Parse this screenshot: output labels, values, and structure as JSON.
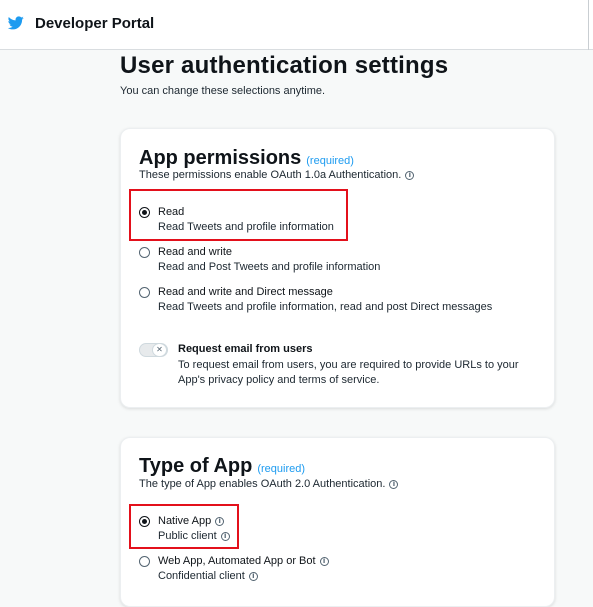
{
  "header": {
    "brand": "Developer Portal",
    "logo_icon": "bird-icon",
    "accent": "#1d9bf0"
  },
  "page": {
    "title": "User authentication settings",
    "subtitle": "You can change these selections anytime."
  },
  "permissions": {
    "title": "App permissions",
    "required": "(required)",
    "description": "These permissions enable OAuth 1.0a Authentication.",
    "options": [
      {
        "label": "Read",
        "desc": "Read Tweets and profile information",
        "selected": true
      },
      {
        "label": "Read and write",
        "desc": "Read and Post Tweets and profile information",
        "selected": false
      },
      {
        "label": "Read and write and Direct message",
        "desc": "Read Tweets and profile information, read and post Direct messages",
        "selected": false
      }
    ],
    "email": {
      "label": "Request email from users",
      "desc": "To request email from users, you are required to provide URLs to your App's privacy policy and terms of service.",
      "enabled": false
    }
  },
  "app_type": {
    "title": "Type of App",
    "required": "(required)",
    "description": "The type of App enables OAuth 2.0 Authentication.",
    "options": [
      {
        "label": "Native App",
        "desc": "Public client",
        "selected": true
      },
      {
        "label": "Web App, Automated App or Bot",
        "desc": "Confidential client",
        "selected": false
      }
    ]
  },
  "highlight_color": "#e3101b"
}
